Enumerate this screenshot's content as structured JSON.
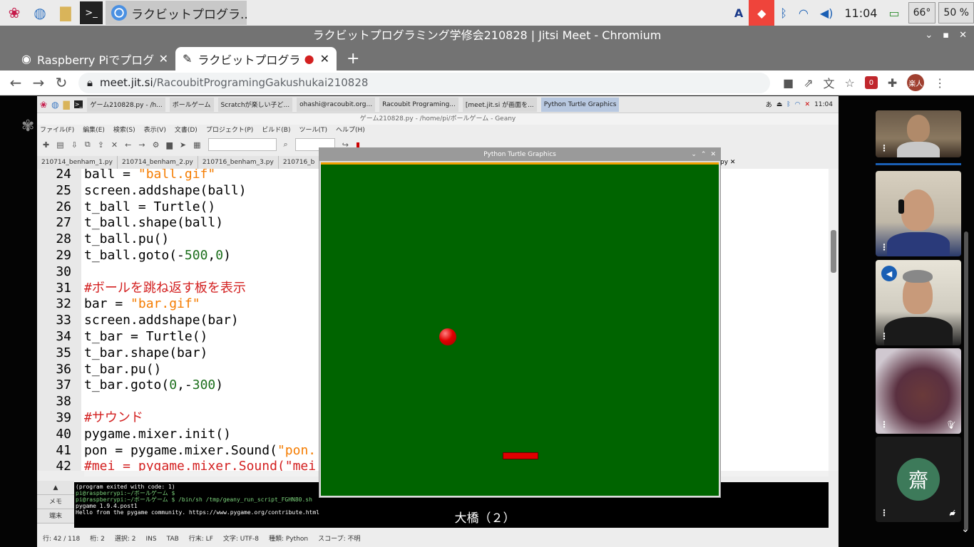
{
  "taskbar": {
    "app_label": "ラクビットプログラ...",
    "tray": {
      "input_method": "A",
      "clock": "11:04",
      "temp": "66°",
      "volume": "50 %"
    }
  },
  "window": {
    "title": "ラクビットプログラミング学修会210828 | Jitsi Meet - Chromium"
  },
  "tabs": [
    {
      "label": "Raspberry Piでプログラ",
      "active": false
    },
    {
      "label": "ラクビットプログラミ",
      "active": true
    }
  ],
  "address": {
    "host": "meet.jit.si",
    "path": "/RacoubitProgramingGakushukai210828"
  },
  "extensions": {
    "ublock_count": "0",
    "profile": "楽人"
  },
  "shared_screen": {
    "pi_panel": {
      "tasks": [
        "ゲーム210828.py - /h...",
        "ボールゲーム",
        "Scratchが楽しい子ど...",
        "ohashi@racoubit.org...",
        "Racoubit Programing...",
        "[meet.jit.si が画面を...",
        "Python Turtle Graphics"
      ],
      "ime": "あ",
      "clock": "11:04"
    },
    "geany": {
      "title": "ゲーム210828.py - /home/pi/ボールゲーム - Geany",
      "menu": [
        "ファイル(F)",
        "編集(E)",
        "検索(S)",
        "表示(V)",
        "文書(D)",
        "プロジェクト(P)",
        "ビルド(B)",
        "ツール(T)",
        "ヘルプ(H)"
      ],
      "doc_tabs": [
        "210714_benham_1.py",
        "210714_benham_2.py",
        "210716_benham_3.py",
        "210716_b"
      ],
      "right_tab_fragment": "py",
      "code_lines": [
        {
          "n": "24",
          "parts": [
            [
              "def",
              "ball = "
            ],
            [
              "str",
              "\"ball.gif\""
            ]
          ]
        },
        {
          "n": "25",
          "parts": [
            [
              "def",
              "screen.addshape(ball)"
            ]
          ]
        },
        {
          "n": "26",
          "parts": [
            [
              "def",
              "t_ball = Turtle()"
            ]
          ]
        },
        {
          "n": "27",
          "parts": [
            [
              "def",
              "t_ball.shape(ball)"
            ]
          ]
        },
        {
          "n": "28",
          "parts": [
            [
              "def",
              "t_ball.pu()"
            ]
          ]
        },
        {
          "n": "29",
          "parts": [
            [
              "def",
              "t_ball.goto(-"
            ],
            [
              "num",
              "500"
            ],
            [
              "def",
              ","
            ],
            [
              "num",
              "0"
            ],
            [
              "def",
              ")"
            ]
          ]
        },
        {
          "n": "30",
          "parts": []
        },
        {
          "n": "31",
          "parts": [
            [
              "cmt",
              "#ボールを跳ね返す板を表示"
            ]
          ]
        },
        {
          "n": "32",
          "parts": [
            [
              "def",
              "bar = "
            ],
            [
              "str",
              "\"bar.gif\""
            ]
          ]
        },
        {
          "n": "33",
          "parts": [
            [
              "def",
              "screen.addshape(bar)"
            ]
          ]
        },
        {
          "n": "34",
          "parts": [
            [
              "def",
              "t_bar = Turtle()"
            ]
          ]
        },
        {
          "n": "35",
          "parts": [
            [
              "def",
              "t_bar.shape(bar)"
            ]
          ]
        },
        {
          "n": "36",
          "parts": [
            [
              "def",
              "t_bar.pu()"
            ]
          ]
        },
        {
          "n": "37",
          "parts": [
            [
              "def",
              "t_bar.goto("
            ],
            [
              "num",
              "0"
            ],
            [
              "def",
              ",-"
            ],
            [
              "num",
              "300"
            ],
            [
              "def",
              ")"
            ]
          ]
        },
        {
          "n": "38",
          "parts": []
        },
        {
          "n": "39",
          "parts": [
            [
              "cmt",
              "#サウンド"
            ]
          ]
        },
        {
          "n": "40",
          "parts": [
            [
              "def",
              "pygame.mixer.init()"
            ]
          ]
        },
        {
          "n": "41",
          "parts": [
            [
              "def",
              "pon = pygame.mixer.Sound("
            ],
            [
              "str",
              "\"pon."
            ]
          ]
        },
        {
          "n": "42",
          "parts": [
            [
              "cmt",
              "#mei = pygame.mixer.Sound(\"mei"
            ]
          ]
        }
      ],
      "msg_tabs": [
        "メモ",
        "端末"
      ],
      "terminal_lines": [
        "(program exited with code: 1)",
        "pi@raspberrypi:~/ボールゲーム $",
        "pi@raspberrypi:~/ボールゲーム $ /bin/sh /tmp/geany_run_script_FGHN80.sh",
        "pygame 1.9.4.post1",
        "Hello from the pygame community. https://www.pygame.org/contribute.html"
      ],
      "status": [
        "行: 42 / 118",
        "桁: 2",
        "選択: 2",
        "INS",
        "TAB",
        "行末: LF",
        "文字: UTF-8",
        "種類: Python",
        "スコープ: 不明"
      ]
    },
    "turtle": {
      "title": "Python Turtle Graphics",
      "bg_color": "#006400",
      "ball_color": "#e00000"
    },
    "caption": "大橋（２）"
  },
  "participants": [
    {
      "type": "video"
    },
    {
      "type": "video"
    },
    {
      "type": "video",
      "dominant": true
    },
    {
      "type": "video",
      "muted": true
    },
    {
      "type": "avatar",
      "initial": "齋",
      "muted": true
    }
  ]
}
